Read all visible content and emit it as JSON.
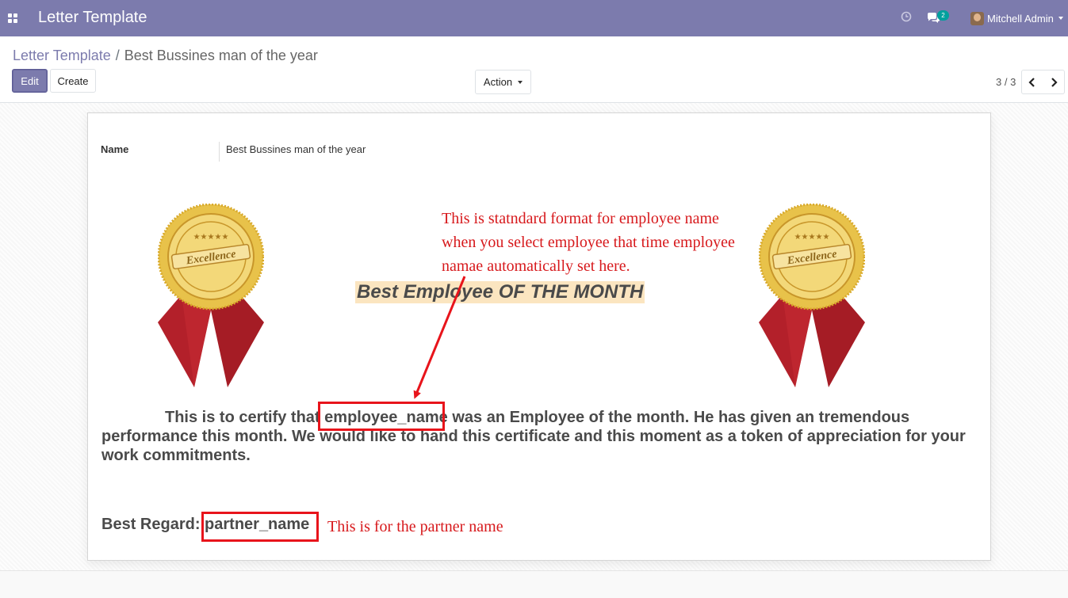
{
  "navbar": {
    "app_title": "Letter Template",
    "messages_count": "2",
    "user_name": "Mitchell Admin",
    "icons": [
      "apps-icon",
      "clock-icon",
      "chat-icon",
      "avatar"
    ]
  },
  "control_panel": {
    "breadcrumb": {
      "parent": "Letter Template",
      "separator": "/",
      "current": "Best Bussines man of the year"
    },
    "edit_label": "Edit",
    "create_label": "Create",
    "action_label": "Action",
    "pager": {
      "value": "3 / 3"
    }
  },
  "form": {
    "name_label": "Name",
    "name_value": "Best Bussines man of the year"
  },
  "certificate": {
    "heading": "Best Employee OF THE MONTH",
    "body_before": "This is to certify that ",
    "employee_placeholder": "employee_name",
    "body_after": " was an Employee of the month. He has given an tremendous performance this month. We would like to hand this certificate and this moment as a token of appreciation for your work commitments.",
    "regards_label": "Best Regard: ",
    "partner_placeholder": "partner_name",
    "seal_text": "Excellence"
  },
  "annotations": {
    "employee_note_lines": [
      "This is statndard format for employee name",
      "when you select employee that time employee",
      "namae automatically set here."
    ],
    "partner_note": "This is for the partner name",
    "annotation_color": "#d7191c"
  },
  "colors": {
    "navbar": "#7c7bad",
    "primary": "#7c7bad",
    "heading_highlight": "#fbe5c0",
    "seal_gold": "#e8c24a",
    "ribbon_red": "#b3202a"
  }
}
